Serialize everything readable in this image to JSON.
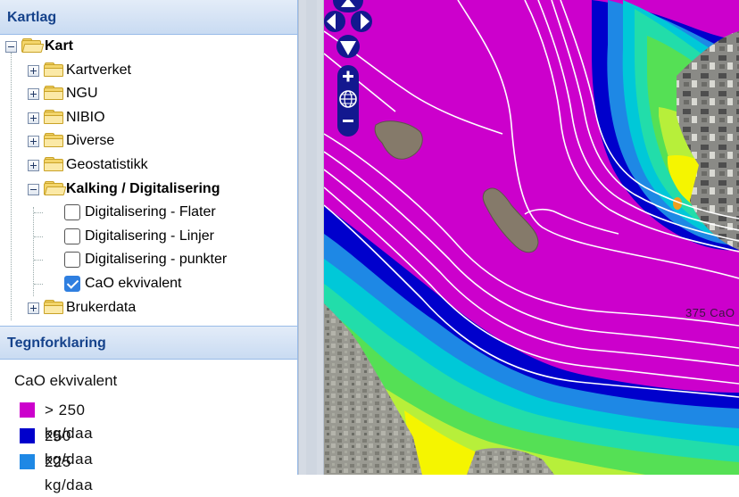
{
  "layers_panel": {
    "title": "Kartlag",
    "tree": [
      {
        "label": "Kart",
        "level": 0,
        "kind": "folder",
        "expanded": true,
        "bold": true
      },
      {
        "label": "Kartverket",
        "level": 1,
        "kind": "folder",
        "expanded": false
      },
      {
        "label": "NGU",
        "level": 1,
        "kind": "folder",
        "expanded": false
      },
      {
        "label": "NIBIO",
        "level": 1,
        "kind": "folder",
        "expanded": false
      },
      {
        "label": "Diverse",
        "level": 1,
        "kind": "folder",
        "expanded": false
      },
      {
        "label": "Geostatistikk",
        "level": 1,
        "kind": "folder",
        "expanded": false
      },
      {
        "label": "Kalking / Digitalisering",
        "level": 1,
        "kind": "folder",
        "expanded": true,
        "bold": true
      },
      {
        "label": "Digitalisering - Flater",
        "level": 2,
        "kind": "layer",
        "checked": false
      },
      {
        "label": "Digitalisering - Linjer",
        "level": 2,
        "kind": "layer",
        "checked": false
      },
      {
        "label": "Digitalisering - punkter",
        "level": 2,
        "kind": "layer",
        "checked": false
      },
      {
        "label": "CaO ekvivalent",
        "level": 2,
        "kind": "layer",
        "checked": true
      },
      {
        "label": "Brukerdata",
        "level": 1,
        "kind": "folder",
        "expanded": false
      }
    ]
  },
  "legend_panel": {
    "title": "Tegnforklaring",
    "layer_title": "CaO ekvivalent",
    "items": [
      {
        "label": "> 250 kg/daa",
        "color": "#cc00cc"
      },
      {
        "label": "250 kg/daa",
        "color": "#0000cc"
      },
      {
        "label": "225 kg/daa",
        "color": "#1e88e5"
      }
    ]
  },
  "map": {
    "contour_label": "375 CaO",
    "controls": {
      "pan_up": "pan-up",
      "pan_left": "pan-left",
      "pan_right": "pan-right",
      "pan_down": "pan-down",
      "zoom_in": "+",
      "zoom_out": "−",
      "zoom_world": "globe"
    },
    "colors": {
      "magenta": "#cc00cc",
      "blue": "#0000cc",
      "mid_blue": "#1e88e5",
      "cyan": "#00c8d8",
      "teal": "#22ddaa",
      "green": "#55e055",
      "lime": "#b7ef3a",
      "yellow": "#f5f500"
    }
  }
}
